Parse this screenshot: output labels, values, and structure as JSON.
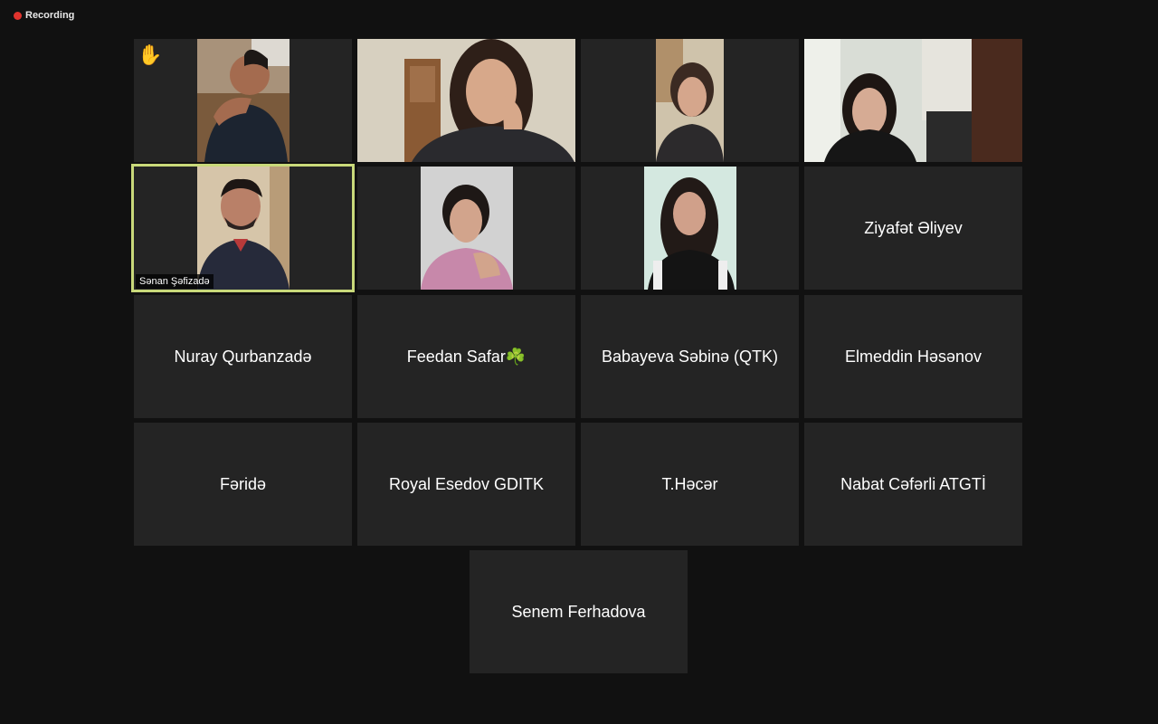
{
  "recording": {
    "label": "Recording"
  },
  "participants": [
    {
      "name": "",
      "video": true,
      "hand": true,
      "hand_icon": "✋"
    },
    {
      "name": "",
      "video": true
    },
    {
      "name": "",
      "video": true
    },
    {
      "name": "",
      "video": true
    },
    {
      "name": "Sənan Şəfizadə",
      "video": true,
      "active_speaker": true
    },
    {
      "name": "",
      "video": true
    },
    {
      "name": "",
      "video": true
    },
    {
      "name": "Ziyafət Əliyev",
      "video": false
    },
    {
      "name": "Nuray Qurbanzadə",
      "video": false
    },
    {
      "name": "Feedan Safar☘️",
      "video": false
    },
    {
      "name": "Babayeva Səbinə (QTK)",
      "video": false
    },
    {
      "name": "Elmeddin Həsənov",
      "video": false
    },
    {
      "name": "Fəridə",
      "video": false
    },
    {
      "name": "Royal Esedov GDITK",
      "video": false
    },
    {
      "name": "T.Həcər",
      "video": false
    },
    {
      "name": "Nabat Cəfərli ATGTİ",
      "video": false
    },
    {
      "name": "Senem Ferhadova",
      "video": false
    }
  ],
  "colors": {
    "active_border": "#c9d97a",
    "recording_dot": "#e0332d",
    "tile_bg": "#242424"
  }
}
